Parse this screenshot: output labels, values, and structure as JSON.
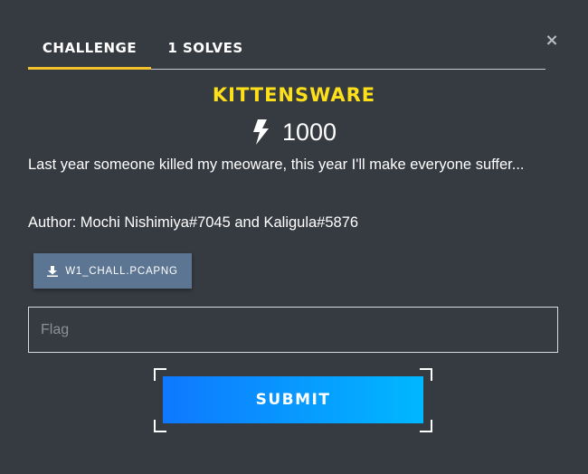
{
  "modal": {
    "close_glyph": "×"
  },
  "tabs": [
    {
      "label": "CHALLENGE",
      "active": true
    },
    {
      "label": "1 SOLVES",
      "active": false
    }
  ],
  "challenge": {
    "name": "KITTENSWARE",
    "points": "1000",
    "points_icon": "lightning-bolt-icon",
    "description": "Last year someone killed my meoware, this year I'll make everyone suffer...",
    "author": "Author: Mochi Nishimiya#7045 and Kaligula#5876"
  },
  "files": [
    {
      "label": "W1_CHALL.PCAPNG",
      "icon": "download-icon"
    }
  ],
  "flag_input": {
    "placeholder": "Flag",
    "value": ""
  },
  "submit": {
    "label": "SUBMIT"
  },
  "colors": {
    "background": "#363a41",
    "title": "#fde01a",
    "tab_active_underline": "#f3c12a",
    "file_button": "#5c7592",
    "submit_gradient_start": "#0f78ff",
    "submit_gradient_end": "#00b8ff"
  }
}
